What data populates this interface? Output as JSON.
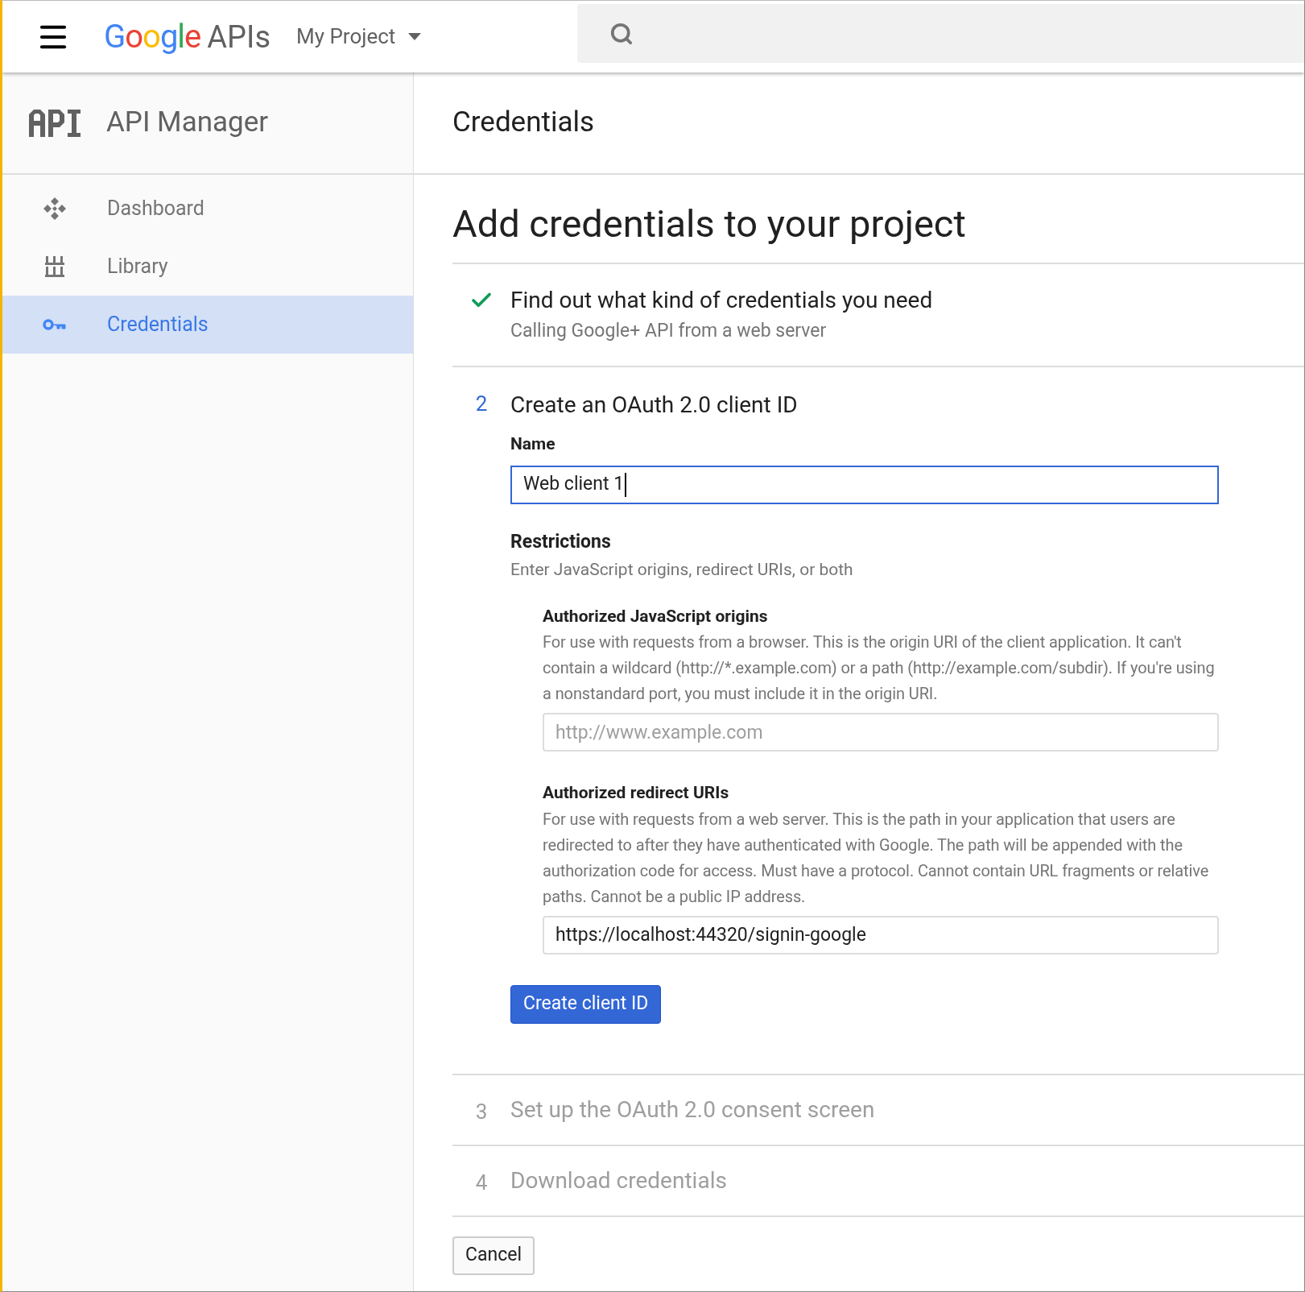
{
  "header": {
    "logo": "Google",
    "product": "APIs",
    "project": "My Project"
  },
  "sidebar": {
    "title": "API Manager",
    "items": [
      {
        "label": "Dashboard",
        "kind": "dashboard",
        "selected": false
      },
      {
        "label": "Library",
        "kind": "library",
        "selected": false
      },
      {
        "label": "Credentials",
        "kind": "key",
        "selected": true
      }
    ]
  },
  "page_title": "Credentials",
  "heading": "Add credentials to your project",
  "steps": [
    {
      "kind": "done",
      "title": "Find out what kind of credentials you need",
      "subtitle": "Calling Google+ API from a web server"
    },
    {
      "kind": "active",
      "number": "2",
      "title": "Create an OAuth 2.0 client ID"
    },
    {
      "kind": "pending",
      "number": "3",
      "title": "Set up the OAuth 2.0 consent screen"
    },
    {
      "kind": "pending",
      "number": "4",
      "title": "Download credentials"
    }
  ],
  "form": {
    "name_label": "Name",
    "name_value": "Web client 1",
    "restrictions_title": "Restrictions",
    "restrictions_hint": "Enter JavaScript origins, redirect URIs, or both",
    "sections": [
      {
        "title": "Authorized JavaScript origins",
        "description": "For use with requests from a browser. This is the origin URI of the client application. It can't contain a wildcard (http://*.example.com) or a path (http://example.com/subdir). If you're using a nonstandard port, you must include it in the origin URI.",
        "placeholder": "http://www.example.com"
      },
      {
        "title": "Authorized redirect URIs",
        "description": "For use with requests from a web server. This is the path in your application that users are redirected to after they have authenticated with Google. The path will be appended with the authorization code for access. Must have a protocol. Cannot contain URL fragments or relative paths. Cannot be a public IP address.",
        "value": "https://localhost:44320/signin-google"
      }
    ],
    "submit": "Create client ID"
  },
  "cancel": "Cancel"
}
